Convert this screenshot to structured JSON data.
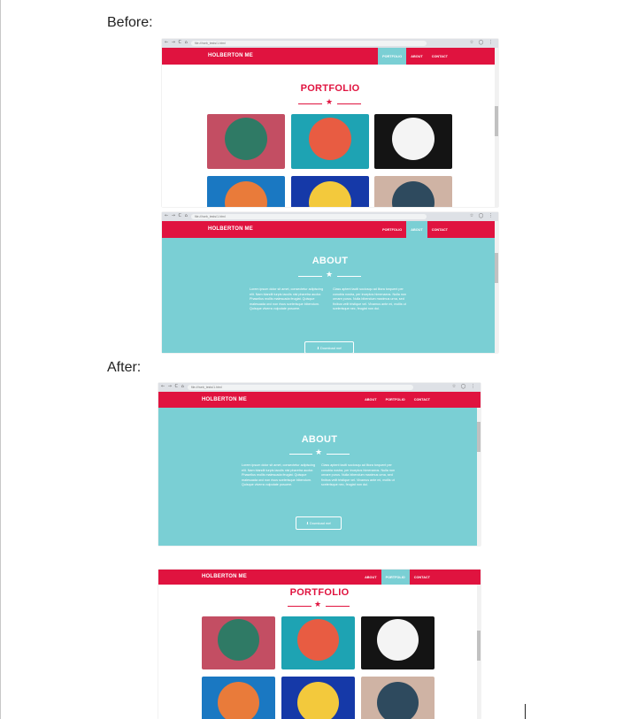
{
  "labels": {
    "before": "Before:",
    "after": "After:"
  },
  "browser": {
    "nav_icons": "← → C ⌂",
    "url": "file:///web_tests/1.html",
    "tools": "☆ ◯ ⋮"
  },
  "site": {
    "brand": "HOLBERTON ME",
    "nav_portfolio": "PORTFOLIO",
    "nav_about": "ABOUT",
    "nav_contact": "CONTACT"
  },
  "portfolio": {
    "title": "PORTFOLIO",
    "star": "★",
    "tiles": [
      {
        "name": "cabin",
        "bg": "#c34e63",
        "disc": "#2f7a65"
      },
      {
        "name": "helmet",
        "bg": "#1ea3b3",
        "disc": "#e85c42"
      },
      {
        "name": "circus-tent",
        "bg": "#141414",
        "disc": "#f4f4f4"
      },
      {
        "name": "gamepad",
        "bg": "#1a78c2",
        "disc": "#e97b3a"
      },
      {
        "name": "slot-machine",
        "bg": "#1539a8",
        "disc": "#f3c93c"
      },
      {
        "name": "submarine",
        "bg": "#cfb3a4",
        "disc": "#2e4a5e"
      }
    ]
  },
  "about": {
    "title": "ABOUT",
    "star": "★",
    "col1": "Lorem ipsum dolor sit amet, consectetur adipiscing elit. Nam blandit turpis iaculis nisl pharetra auctor. Phasellus mollis malesuada feugiat. Quisque malesuada orci non risus scelerisque bibendum. Quisque viverra vulputate posuere.",
    "col2": "Class aptent taciti sociosqu ad litora torquent per conubia nostra, per inceptos himenaeos. Nulla non ornare purus. Nulla bibendum maximus urna, sed finibus velit tristique vel. Vivamus ante mi, mollis ut scelerisque nec, feugiat non dui.",
    "download_label": "⬇  Download me!"
  },
  "colors": {
    "brand_red": "#e0133f",
    "about_teal": "#7acfd4"
  }
}
